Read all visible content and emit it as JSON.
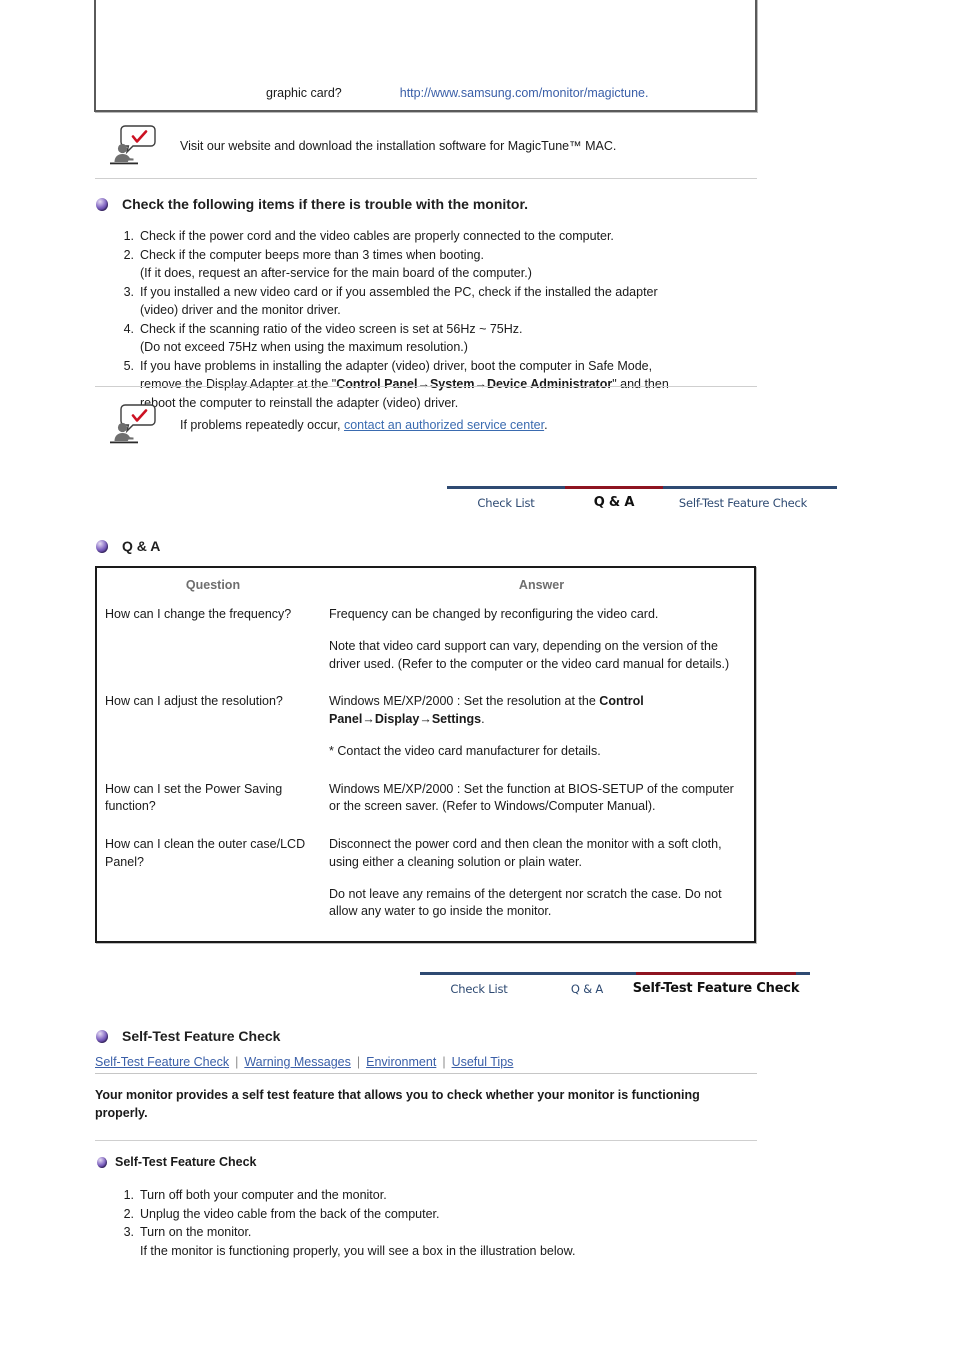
{
  "top_box": {
    "question_fragment": "graphic card?",
    "link_text": "http://www.samsung.com/monitor/magictune."
  },
  "tip_top": {
    "icon": "person-speech-check-icon",
    "text": "Visit our website and download the installation software for MagicTune™ MAC."
  },
  "check_list": {
    "heading": "Check the following items if there is trouble with the monitor.",
    "items": [
      {
        "n": "1.",
        "lines": [
          {
            "text": "Check if the power cord and the video cables are properly connected to the computer."
          }
        ]
      },
      {
        "n": "2.",
        "lines": [
          {
            "text": "Check if the computer beeps more than 3 times when booting."
          },
          {
            "text": "(If it does, request an after-service for the main board of the computer.)"
          }
        ]
      },
      {
        "n": "3.",
        "lines": [
          {
            "text": "If you installed a new video card or if you assembled the PC, check if the installed the adapter"
          },
          {
            "text": "(video) driver and the monitor driver."
          }
        ]
      },
      {
        "n": "4.",
        "lines": [
          {
            "text": "Check if the scanning ratio of the video screen is set at 56Hz ~ 75Hz."
          },
          {
            "text": "(Do not exceed 75Hz when using the maximum resolution.)"
          }
        ]
      },
      {
        "n": "5.",
        "lines": [
          {
            "text": "If you have problems in installing the adapter (video) driver, boot the computer in Safe Mode,"
          },
          {
            "pre": "remove the Display Adapter at the \"",
            "bold": "Control Panel→System→Device Administrator",
            "post": "\" and then"
          },
          {
            "text": "reboot the computer to reinstall the adapter (video) driver."
          }
        ]
      }
    ]
  },
  "tip_service": {
    "icon": "person-speech-check-icon",
    "prefix": "If problems repeatedly occur, ",
    "link_text": "contact an authorized service center",
    "suffix": "."
  },
  "tabstrip_qa": {
    "tabs": [
      {
        "label": "Check List",
        "active": false
      },
      {
        "label": "Q & A",
        "active": true
      },
      {
        "label": "Self-Test Feature Check",
        "active": false
      },
      {
        "label": "",
        "active": false
      }
    ]
  },
  "qa_section": {
    "heading": "Q & A",
    "columns": [
      "Question",
      "Answer"
    ],
    "rows": [
      {
        "question": "How can I change the frequency?",
        "answer_paragraphs": [
          {
            "text": "Frequency can be changed by reconfiguring the video card."
          },
          {
            "text": "Note that video card support can vary, depending on the version of the driver used. (Refer to the computer or the video card manual for details.)"
          }
        ]
      },
      {
        "question": "How can I adjust the resolution?",
        "answer_paragraphs": [
          {
            "pre": "Windows ME/XP/2000 : Set the resolution at the ",
            "bold": "Control Panel→Display→Settings",
            "post": "."
          },
          {
            "text": "* Contact the video card manufacturer for details."
          }
        ]
      },
      {
        "question": "How can I set the Power Saving function?",
        "answer_paragraphs": [
          {
            "text": "Windows ME/XP/2000 : Set the function at BIOS-SETUP of the computer or the screen saver. (Refer to Windows/Computer Manual)."
          }
        ]
      },
      {
        "question": "How can I clean the outer case/LCD Panel?",
        "answer_paragraphs": [
          {
            "text": "Disconnect the power cord and then clean the monitor with a soft cloth, using either a cleaning solution or plain water."
          },
          {
            "text": "Do not leave any remains of the detergent nor scratch the case. Do not allow any water to go inside the monitor."
          }
        ]
      }
    ]
  },
  "tabstrip_selftest": {
    "tabs": [
      {
        "label": "Check List",
        "active": false
      },
      {
        "label": "Q & A",
        "active": false
      },
      {
        "label": "Self-Test Feature Check",
        "active": true
      },
      {
        "label": "",
        "active": false
      }
    ]
  },
  "selftest_section": {
    "heading": "Self-Test Feature Check",
    "subnav": [
      "Self-Test Feature Check",
      "Warning Messages",
      "Environment",
      "Useful Tips"
    ],
    "subnav_separator": "|",
    "lead": "Your monitor provides a self test feature that allows you to check whether your monitor is functioning properly.",
    "sub_heading": "Self-Test Feature Check",
    "steps": [
      {
        "n": "1.",
        "lines": [
          {
            "text": "Turn off both your computer and the monitor."
          }
        ]
      },
      {
        "n": "2.",
        "lines": [
          {
            "text": "Unplug the video cable from the back of the computer."
          }
        ]
      },
      {
        "n": "3.",
        "lines": [
          {
            "text": "Turn on the monitor."
          },
          {
            "text": "If the monitor is functioning properly, you will see a box in the illustration below."
          }
        ]
      }
    ]
  },
  "colors": {
    "link": "#3a5fa8",
    "tab_inactive": "#2e4a72",
    "tab_active_border": "#8e1420",
    "bullet": "#5b3f9e",
    "table_border": "#1a1a1a"
  }
}
